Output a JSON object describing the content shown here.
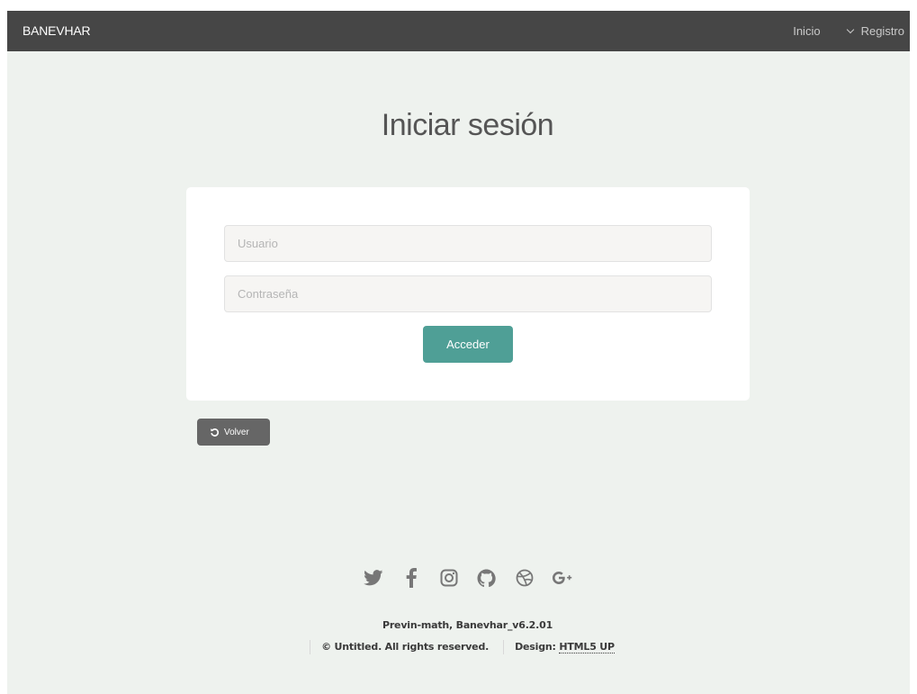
{
  "header": {
    "brand": "BANEVHAR",
    "nav": {
      "inicio": "Inicio",
      "registro": "Registro"
    }
  },
  "main": {
    "title": "Iniciar sesión",
    "form": {
      "username": {
        "placeholder": "Usuario",
        "value": ""
      },
      "password": {
        "placeholder": "Contraseña",
        "value": ""
      },
      "submit_label": "Acceder"
    },
    "back_label": "Volver"
  },
  "footer": {
    "social_icons": [
      "twitter-icon",
      "facebook-icon",
      "instagram-icon",
      "github-icon",
      "dribbble-icon",
      "google-plus-icon"
    ],
    "version": "Previn-math, Banevhar_v6.2.01",
    "copyright": "© Untitled. All rights reserved.",
    "design_prefix": "Design:",
    "design_link": "HTML5 UP"
  },
  "colors": {
    "topbar": "#464646",
    "background": "#eef2ee",
    "accent": "#4f9f96",
    "back_button": "#666666"
  }
}
